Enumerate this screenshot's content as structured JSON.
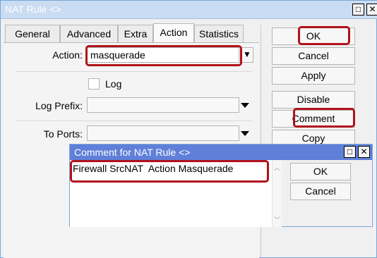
{
  "window": {
    "title": "NAT Rule <>",
    "restore_glyph": "□",
    "close_glyph": "✕"
  },
  "tabs": [
    {
      "label": "General"
    },
    {
      "label": "Advanced"
    },
    {
      "label": "Extra"
    },
    {
      "label": "Action"
    },
    {
      "label": "Statistics"
    }
  ],
  "form": {
    "action_label": "Action:",
    "action_value": "masquerade",
    "log_label": "Log",
    "log_prefix_label": "Log Prefix:",
    "log_prefix_value": "",
    "to_ports_label": "To Ports:",
    "to_ports_value": ""
  },
  "side_buttons": {
    "ok": "OK",
    "cancel": "Cancel",
    "apply": "Apply",
    "disable": "Disable",
    "comment": "Comment",
    "copy": "Copy"
  },
  "dialog": {
    "title": "Comment for NAT Rule <>",
    "comment_text": "Firewall SrcNAT  Action Masquerade",
    "ok": "OK",
    "cancel": "Cancel",
    "restore_glyph": "□",
    "close_glyph": "✕"
  }
}
